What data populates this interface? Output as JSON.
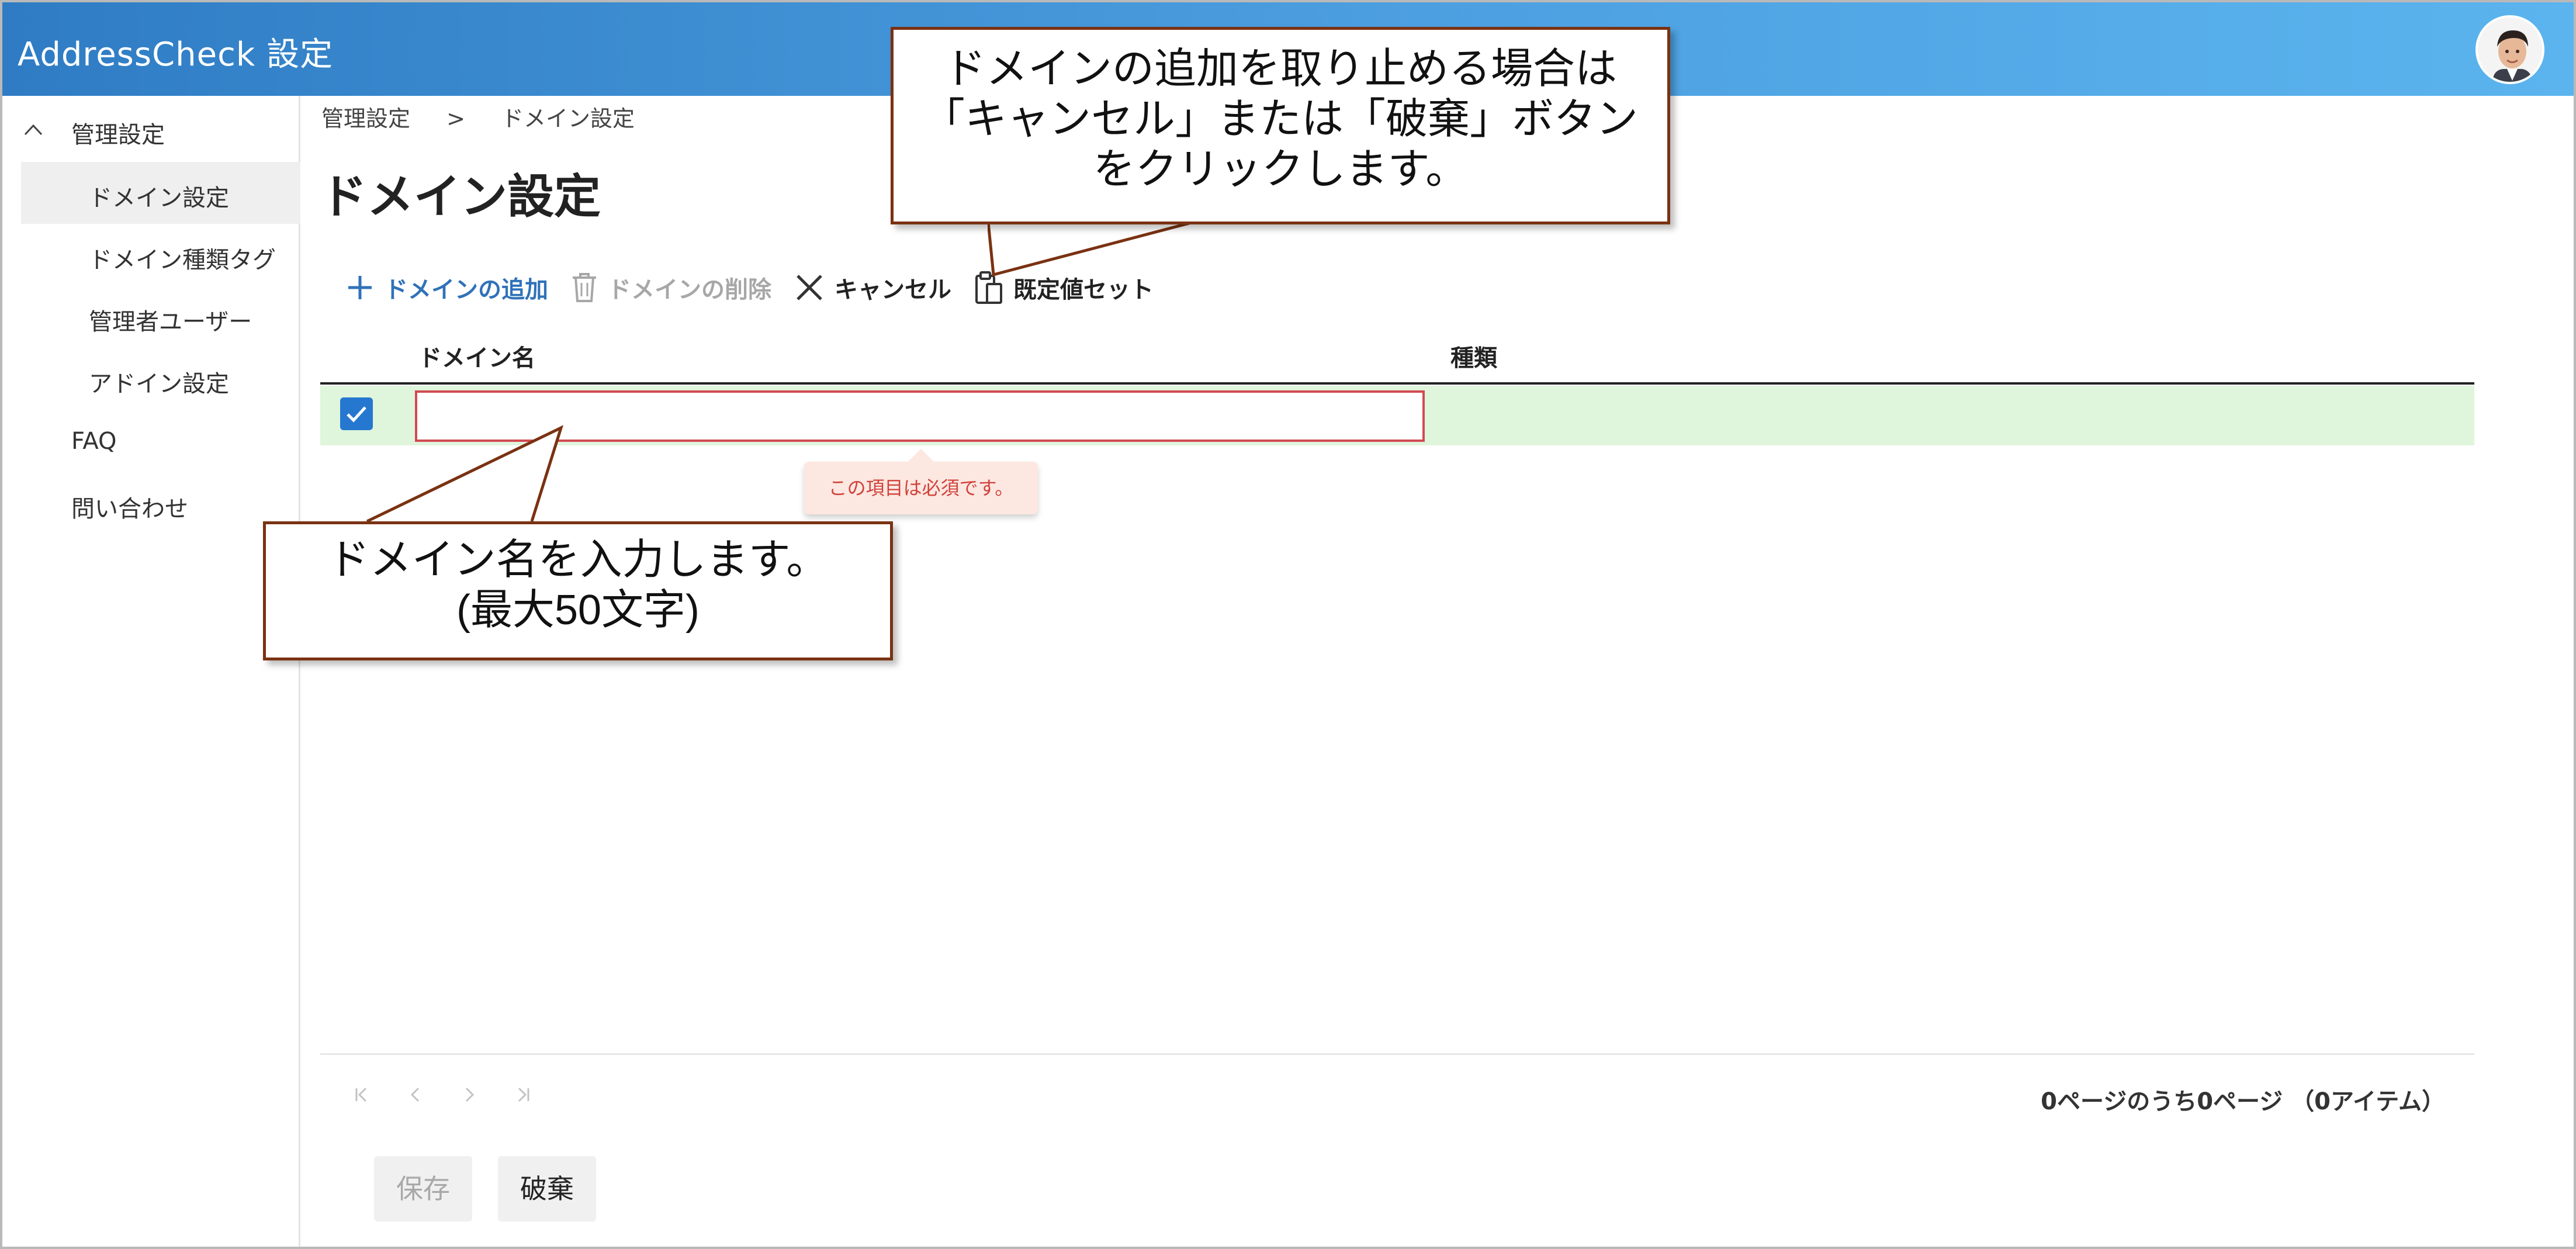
{
  "app": {
    "title": "AddressCheck 設定"
  },
  "sidebar": {
    "group_label": "管理設定",
    "items": [
      {
        "label": "ドメイン設定"
      },
      {
        "label": "ドメイン種類タグ"
      },
      {
        "label": "管理者ユーザー"
      },
      {
        "label": "アドイン設定"
      }
    ],
    "faq": "FAQ",
    "contact": "問い合わせ"
  },
  "breadcrumb": {
    "parent": "管理設定",
    "separator": ">",
    "current": "ドメイン設定"
  },
  "page": {
    "title": "ドメイン設定"
  },
  "toolbar": {
    "add": "ドメインの追加",
    "delete": "ドメインの削除",
    "cancel": "キャンセル",
    "defaults": "既定値セット"
  },
  "grid": {
    "columns": [
      "ドメイン名",
      "種類"
    ],
    "row_input_value": "",
    "validation_message": "この項目は必須です。"
  },
  "pager": {
    "info": "0ページのうち0ページ （0アイテム）"
  },
  "actions": {
    "save": "保存",
    "discard": "破棄"
  },
  "callouts": {
    "top": [
      "ドメインの追加を取り止める場合は",
      "「キャンセル」または「破棄」ボタン",
      "をクリックします。"
    ],
    "bottom": [
      "ドメイン名を入力します。",
      "(最大50文字)"
    ]
  },
  "colors": {
    "header_start": "#2f7cc4",
    "header_end": "#5bb4ee",
    "accent": "#2677d0",
    "error": "#d24a52",
    "row_new": "#dff5dc",
    "callout_border": "#7a3212"
  }
}
